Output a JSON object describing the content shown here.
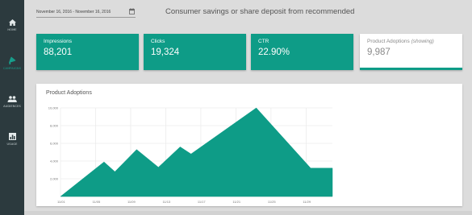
{
  "sidebar": {
    "items": [
      {
        "label": "HOME",
        "icon": "home-icon",
        "active": false
      },
      {
        "label": "CAMPAIGNS",
        "icon": "megaphone-icon",
        "active": true
      },
      {
        "label": "AUDIENCES",
        "icon": "people-icon",
        "active": false
      },
      {
        "label": "USAGE",
        "icon": "chart-icon",
        "active": false
      }
    ]
  },
  "header": {
    "date_range": "November 16, 2016 - November 16, 2016",
    "title": "Consumer savings or share deposit from recommended"
  },
  "cards": [
    {
      "label": "Impressions",
      "value": "88,201"
    },
    {
      "label": "Clicks",
      "value": "19,324"
    },
    {
      "label": "CTR",
      "value": "22.90%"
    },
    {
      "label": "Product Adoptions",
      "note": "(showing)",
      "value": "9,987"
    }
  ],
  "colors": {
    "accent": "#0e9c87",
    "sidebar": "#2c3a3e"
  },
  "chart_data": {
    "type": "area",
    "title": "Product Adoptions",
    "xlabel": "",
    "ylabel": "",
    "x": [
      "11/01",
      "11/05",
      "11/09",
      "11/13",
      "11/17",
      "11/21",
      "11/25",
      "11/29",
      "12/03"
    ],
    "ylim": [
      0,
      10000
    ],
    "y_ticks": [
      "2,000",
      "4,000",
      "6,000",
      "8,000",
      "10,000"
    ],
    "x_tick_labels": [
      "11/01",
      "11/05",
      "11/09",
      "11/13",
      "11/17",
      "11/21",
      "11/25",
      "11/29"
    ],
    "points": [
      {
        "x": 0,
        "y": 0
      },
      {
        "x": 4,
        "y": 3900
      },
      {
        "x": 5,
        "y": 2800
      },
      {
        "x": 7,
        "y": 5300
      },
      {
        "x": 9,
        "y": 3300
      },
      {
        "x": 11,
        "y": 5600
      },
      {
        "x": 12,
        "y": 4800
      },
      {
        "x": 18,
        "y": 10000
      },
      {
        "x": 23,
        "y": 3200
      },
      {
        "x": 25,
        "y": 3200
      }
    ],
    "grid": true
  }
}
